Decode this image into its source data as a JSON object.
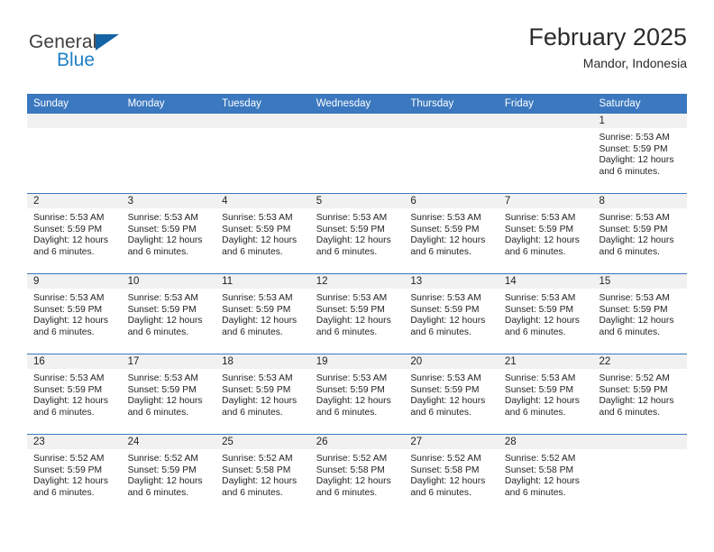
{
  "logo": {
    "text_primary": "General",
    "text_secondary": "Blue",
    "triangle_color": "#1464a5",
    "secondary_color": "#1f7fc4"
  },
  "header": {
    "title": "February 2025",
    "subtitle": "Mandor, Indonesia"
  },
  "theme": {
    "header_blue": "#3b78bf",
    "daynum_band": "#f1f1f1",
    "text": "#231f20"
  },
  "calendar": {
    "weekday_headers": [
      "Sunday",
      "Monday",
      "Tuesday",
      "Wednesday",
      "Thursday",
      "Friday",
      "Saturday"
    ],
    "weeks": [
      [
        {
          "day": "",
          "empty": true
        },
        {
          "day": "",
          "empty": true
        },
        {
          "day": "",
          "empty": true
        },
        {
          "day": "",
          "empty": true
        },
        {
          "day": "",
          "empty": true
        },
        {
          "day": "",
          "empty": true
        },
        {
          "day": "1",
          "sunrise": "Sunrise: 5:53 AM",
          "sunset": "Sunset: 5:59 PM",
          "daylight": "Daylight: 12 hours and 6 minutes."
        }
      ],
      [
        {
          "day": "2",
          "sunrise": "Sunrise: 5:53 AM",
          "sunset": "Sunset: 5:59 PM",
          "daylight": "Daylight: 12 hours and 6 minutes."
        },
        {
          "day": "3",
          "sunrise": "Sunrise: 5:53 AM",
          "sunset": "Sunset: 5:59 PM",
          "daylight": "Daylight: 12 hours and 6 minutes."
        },
        {
          "day": "4",
          "sunrise": "Sunrise: 5:53 AM",
          "sunset": "Sunset: 5:59 PM",
          "daylight": "Daylight: 12 hours and 6 minutes."
        },
        {
          "day": "5",
          "sunrise": "Sunrise: 5:53 AM",
          "sunset": "Sunset: 5:59 PM",
          "daylight": "Daylight: 12 hours and 6 minutes."
        },
        {
          "day": "6",
          "sunrise": "Sunrise: 5:53 AM",
          "sunset": "Sunset: 5:59 PM",
          "daylight": "Daylight: 12 hours and 6 minutes."
        },
        {
          "day": "7",
          "sunrise": "Sunrise: 5:53 AM",
          "sunset": "Sunset: 5:59 PM",
          "daylight": "Daylight: 12 hours and 6 minutes."
        },
        {
          "day": "8",
          "sunrise": "Sunrise: 5:53 AM",
          "sunset": "Sunset: 5:59 PM",
          "daylight": "Daylight: 12 hours and 6 minutes."
        }
      ],
      [
        {
          "day": "9",
          "sunrise": "Sunrise: 5:53 AM",
          "sunset": "Sunset: 5:59 PM",
          "daylight": "Daylight: 12 hours and 6 minutes."
        },
        {
          "day": "10",
          "sunrise": "Sunrise: 5:53 AM",
          "sunset": "Sunset: 5:59 PM",
          "daylight": "Daylight: 12 hours and 6 minutes."
        },
        {
          "day": "11",
          "sunrise": "Sunrise: 5:53 AM",
          "sunset": "Sunset: 5:59 PM",
          "daylight": "Daylight: 12 hours and 6 minutes."
        },
        {
          "day": "12",
          "sunrise": "Sunrise: 5:53 AM",
          "sunset": "Sunset: 5:59 PM",
          "daylight": "Daylight: 12 hours and 6 minutes."
        },
        {
          "day": "13",
          "sunrise": "Sunrise: 5:53 AM",
          "sunset": "Sunset: 5:59 PM",
          "daylight": "Daylight: 12 hours and 6 minutes."
        },
        {
          "day": "14",
          "sunrise": "Sunrise: 5:53 AM",
          "sunset": "Sunset: 5:59 PM",
          "daylight": "Daylight: 12 hours and 6 minutes."
        },
        {
          "day": "15",
          "sunrise": "Sunrise: 5:53 AM",
          "sunset": "Sunset: 5:59 PM",
          "daylight": "Daylight: 12 hours and 6 minutes."
        }
      ],
      [
        {
          "day": "16",
          "sunrise": "Sunrise: 5:53 AM",
          "sunset": "Sunset: 5:59 PM",
          "daylight": "Daylight: 12 hours and 6 minutes."
        },
        {
          "day": "17",
          "sunrise": "Sunrise: 5:53 AM",
          "sunset": "Sunset: 5:59 PM",
          "daylight": "Daylight: 12 hours and 6 minutes."
        },
        {
          "day": "18",
          "sunrise": "Sunrise: 5:53 AM",
          "sunset": "Sunset: 5:59 PM",
          "daylight": "Daylight: 12 hours and 6 minutes."
        },
        {
          "day": "19",
          "sunrise": "Sunrise: 5:53 AM",
          "sunset": "Sunset: 5:59 PM",
          "daylight": "Daylight: 12 hours and 6 minutes."
        },
        {
          "day": "20",
          "sunrise": "Sunrise: 5:53 AM",
          "sunset": "Sunset: 5:59 PM",
          "daylight": "Daylight: 12 hours and 6 minutes."
        },
        {
          "day": "21",
          "sunrise": "Sunrise: 5:53 AM",
          "sunset": "Sunset: 5:59 PM",
          "daylight": "Daylight: 12 hours and 6 minutes."
        },
        {
          "day": "22",
          "sunrise": "Sunrise: 5:52 AM",
          "sunset": "Sunset: 5:59 PM",
          "daylight": "Daylight: 12 hours and 6 minutes."
        }
      ],
      [
        {
          "day": "23",
          "sunrise": "Sunrise: 5:52 AM",
          "sunset": "Sunset: 5:59 PM",
          "daylight": "Daylight: 12 hours and 6 minutes."
        },
        {
          "day": "24",
          "sunrise": "Sunrise: 5:52 AM",
          "sunset": "Sunset: 5:59 PM",
          "daylight": "Daylight: 12 hours and 6 minutes."
        },
        {
          "day": "25",
          "sunrise": "Sunrise: 5:52 AM",
          "sunset": "Sunset: 5:58 PM",
          "daylight": "Daylight: 12 hours and 6 minutes."
        },
        {
          "day": "26",
          "sunrise": "Sunrise: 5:52 AM",
          "sunset": "Sunset: 5:58 PM",
          "daylight": "Daylight: 12 hours and 6 minutes."
        },
        {
          "day": "27",
          "sunrise": "Sunrise: 5:52 AM",
          "sunset": "Sunset: 5:58 PM",
          "daylight": "Daylight: 12 hours and 6 minutes."
        },
        {
          "day": "28",
          "sunrise": "Sunrise: 5:52 AM",
          "sunset": "Sunset: 5:58 PM",
          "daylight": "Daylight: 12 hours and 6 minutes."
        },
        {
          "day": "",
          "empty": true
        }
      ]
    ]
  }
}
